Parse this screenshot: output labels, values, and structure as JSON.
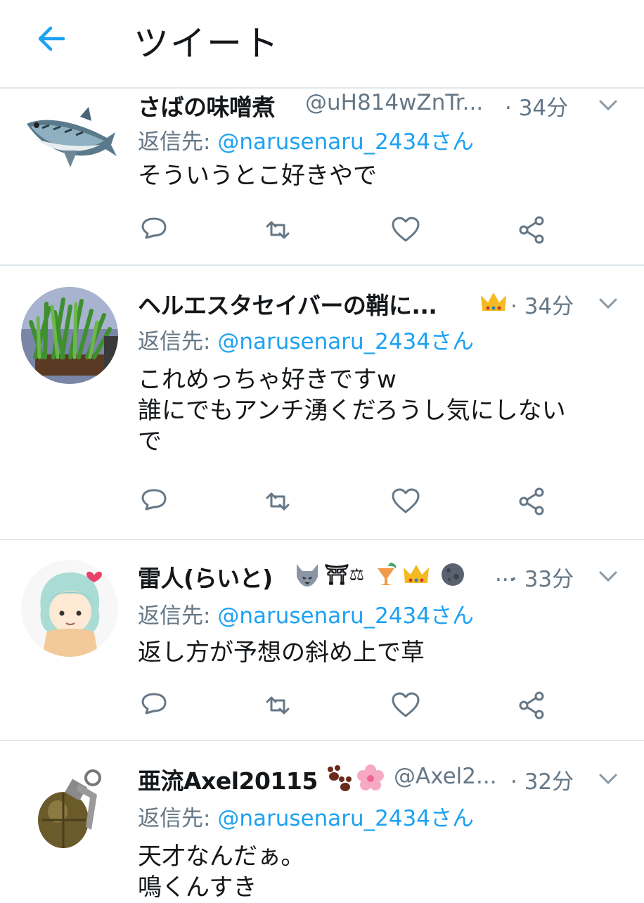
{
  "header": {
    "title": "ツイート"
  },
  "colors": {
    "accent": "#1da1f2",
    "muted": "#657786",
    "text": "#14171a",
    "divider": "#e1e8ed"
  },
  "tweets": [
    {
      "name": "さばの味噌煮",
      "handle": "@uH814wZnTr...",
      "time": "· 34分",
      "reply_prefix": "返信先: ",
      "reply_mention": "@narusenaru_2434さん",
      "text_lines": [
        "そういうとこ好きやで"
      ],
      "avatar": "mackerel-fish"
    },
    {
      "name": "ヘルエスタセイバーの鞘に...",
      "handle": "",
      "time": "· 34分",
      "reply_prefix": "返信先: ",
      "reply_mention": "@narusenaru_2434さん",
      "text_lines": [
        "これめっちゃ好きですw",
        "誰にでもアンチ湧くだろうし気にしない",
        "で"
      ],
      "avatar": "potted-grass"
    },
    {
      "name": "雷人(らいと)",
      "name_suffix": "...",
      "handle": "",
      "time": "· 33分",
      "reply_prefix": "返信先: ",
      "reply_mention": "@narusenaru_2434さん",
      "text_lines": [
        "返し方が予想の斜め上で草"
      ],
      "avatar": "anime-character"
    },
    {
      "name": "亜流Axel20115",
      "handle": "@Axel2...",
      "time": "· 32分",
      "reply_prefix": "返信先: ",
      "reply_mention": "@narusenaru_2434さん",
      "text_lines": [
        "天才なんだぁ。",
        "鳴くんすき"
      ],
      "avatar": "grenade"
    }
  ]
}
